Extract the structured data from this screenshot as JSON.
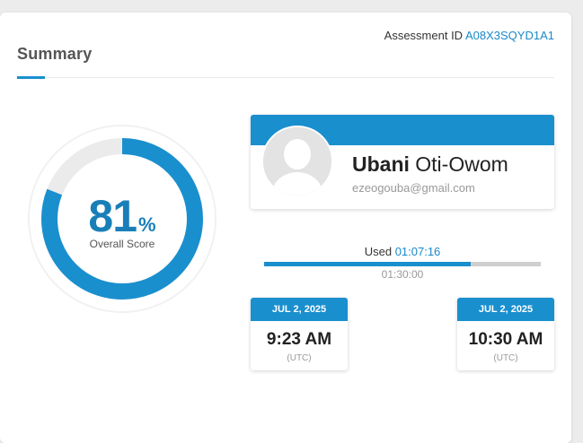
{
  "colors": {
    "accent": "#1a8fce",
    "score_track": "#ebebeb",
    "muted_text": "#999999"
  },
  "summary": {
    "title": "Summary",
    "assessment_label": "Assessment ID",
    "assessment_id": "A08X3SQYD1A1"
  },
  "score": {
    "value": "81",
    "unit": "%",
    "label": "Overall Score",
    "percent": 81
  },
  "candidate": {
    "first_name": "Ubani",
    "last_name": "Oti-Owom",
    "email": "ezeogouba@gmail.com",
    "avatar_icon": "user-placeholder-icon"
  },
  "time": {
    "used_label": "Used",
    "used_value": "01:07:16",
    "total": "01:30:00",
    "progress_fraction": 0.7476
  },
  "start": {
    "date": "JUL 2, 2025",
    "time": "9:23 AM",
    "tz": "(UTC)"
  },
  "end": {
    "date": "JUL 2, 2025",
    "time": "10:30 AM",
    "tz": "(UTC)"
  }
}
